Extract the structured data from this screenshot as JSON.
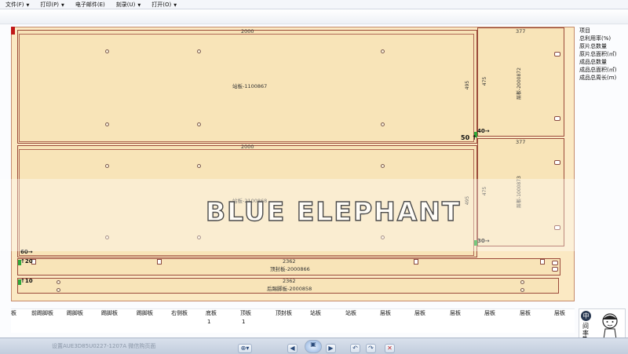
{
  "menu": [
    {
      "label": "文件(F)",
      "has_arrow": true
    },
    {
      "label": "打印(P)",
      "has_arrow": true
    },
    {
      "label": "电子邮件(E)",
      "has_arrow": false
    },
    {
      "label": "刻录(U)",
      "has_arrow": true
    },
    {
      "label": "打开(O)",
      "has_arrow": true
    }
  ],
  "colors": {
    "sheet": "#fbe9c3",
    "part": "#f8e4b8",
    "part_border": "#9b4a3a",
    "marker_green": "#2fa83a",
    "marker_red": "#c01818"
  },
  "parts": {
    "p1": {
      "width": "2000",
      "height": "495",
      "label": "站板-1100867"
    },
    "p2": {
      "width": "2000",
      "height": "495",
      "label": "站板-2100868"
    },
    "p3": {
      "width": "377",
      "height": "475",
      "label": "层板-2000872"
    },
    "p4": {
      "width": "377",
      "height": "475",
      "label": "层板-1000873"
    },
    "p5": {
      "width": "2362",
      "label": "顶封板-2000866"
    },
    "p6": {
      "width": "2362",
      "label": "后踢脚板-2000858"
    }
  },
  "markers": {
    "m50": "50",
    "m40": "40",
    "m30": "30",
    "m60": "60",
    "m20": "20",
    "m10": "10"
  },
  "side_panel": {
    "items": [
      "项目",
      "总利用率(%)",
      "原片总数量",
      "原片总面积(㎡)",
      "成品总数量",
      "成品总面积(㎡)",
      "成品总周长(m)"
    ]
  },
  "table": {
    "columns": [
      {
        "label": "板",
        "value": ""
      },
      {
        "label": "前踢脚板",
        "value": ""
      },
      {
        "label": "踢脚板",
        "value": ""
      },
      {
        "label": "踢脚板",
        "value": ""
      },
      {
        "label": "踢脚板",
        "value": ""
      },
      {
        "label": "右侧板",
        "value": ""
      },
      {
        "label": "底板",
        "value": "1"
      },
      {
        "label": "顶板",
        "value": "1"
      },
      {
        "label": "顶封板",
        "value": ""
      },
      {
        "label": "站板",
        "value": ""
      },
      {
        "label": "站板",
        "value": ""
      },
      {
        "label": "层板",
        "value": ""
      },
      {
        "label": "层板",
        "value": ""
      },
      {
        "label": "层板",
        "value": ""
      },
      {
        "label": "层板",
        "value": ""
      },
      {
        "label": "层板",
        "value": ""
      },
      {
        "label": "层板",
        "value": ""
      }
    ]
  },
  "watermark": "BLUE ELEPHANT",
  "avatar": {
    "badge": "中",
    "line1": "间",
    "line2": "率",
    "heart": "❤"
  },
  "status_text": "设置AUE3D85U0227-1207A 微信购页面",
  "toolbar": {
    "zoom": "⊕▾",
    "prev": "◀",
    "play": "▣",
    "next": "▶",
    "rotate_left": "↶",
    "rotate_right": "↷",
    "delete": "✕"
  },
  "icons": [
    "chevron-down-icon",
    "arrow-right-icon",
    "arrow-up-icon",
    "zoom-icon",
    "previous-icon",
    "slideshow-icon",
    "next-icon",
    "rotate-left-icon",
    "rotate-right-icon",
    "delete-icon",
    "heart-icon"
  ]
}
